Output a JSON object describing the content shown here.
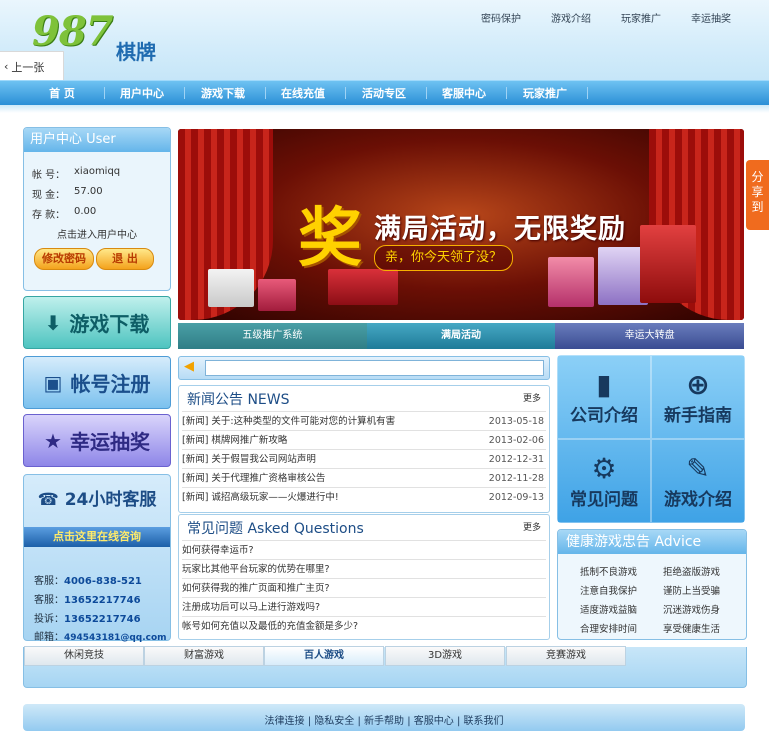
{
  "site": {
    "logo_number": "987",
    "logo_name": "棋牌"
  },
  "top_links": [
    "密码保护",
    "游戏介绍",
    "玩家推广",
    "幸运抽奖"
  ],
  "prev_button": "上一张",
  "nav": [
    "首 页",
    "用户中心",
    "游戏下载",
    "在线充值",
    "活动专区",
    "客服中心",
    "玩家推广"
  ],
  "user_panel": {
    "title": "用户中心 User",
    "account_label": "帐 号：",
    "account_value": "xiaomiqq",
    "cash_label": "现 金：",
    "cash_value": "57.00",
    "deposit_label": "存 款：",
    "deposit_value": "0.00",
    "enter_link": "点击进入用户中心",
    "change_pwd": "修改密码",
    "logout": "退 出"
  },
  "side_buttons": {
    "download": "游戏下载",
    "register": "帐号注册",
    "lottery": "幸运抽奖"
  },
  "service": {
    "title": "24小时客服",
    "online": "点击这里在线咨询",
    "lines": [
      {
        "label": "客服：",
        "value": "4006-838-521"
      },
      {
        "label": "客服：",
        "value": "13652217746"
      },
      {
        "label": "投诉：",
        "value": "13652217746"
      },
      {
        "label": "邮箱：",
        "value": "494543181@qq.com"
      }
    ]
  },
  "banner": {
    "big": "奖",
    "headline": "满局活动，无限奖励",
    "sub": "亲，你今天领了没？"
  },
  "banner_tabs": [
    "五级推广系统",
    "满局活动",
    "幸运大转盘"
  ],
  "news": {
    "title": "新闻公告 NEWS",
    "more": "更多",
    "items": [
      {
        "text": "[新闻] 关于:这种类型的文件可能对您的计算机有害",
        "date": "2013-05-18"
      },
      {
        "text": "[新闻] 棋牌网推广新攻略",
        "date": "2013-02-06"
      },
      {
        "text": "[新闻] 关于假冒我公司网站声明",
        "date": "2012-12-31"
      },
      {
        "text": "[新闻] 关于代理推广资格审核公告",
        "date": "2012-11-28"
      },
      {
        "text": "[新闻] 诚招高级玩家——火爆进行中!",
        "date": "2012-09-13"
      }
    ]
  },
  "faq": {
    "title": "常见问题 Asked Questions",
    "more": "更多",
    "items": [
      "如何获得幸运币?",
      "玩家比其他平台玩家的优势在哪里?",
      "如何获得我的推广页面和推广主页?",
      "注册成功后可以马上进行游戏吗?",
      "帐号如何充值以及最低的充值金额是多少?"
    ]
  },
  "quick": {
    "about": "公司介绍",
    "guide": "新手指南",
    "faq": "常见问题",
    "games": "游戏介绍"
  },
  "advice": {
    "title": "健康游戏忠告 Advice",
    "items": [
      "抵制不良游戏",
      "拒绝盗版游戏",
      "注意自我保护",
      "谨防上当受骗",
      "适度游戏益脑",
      "沉迷游戏伤身",
      "合理安排时间",
      "享受健康生活"
    ]
  },
  "game_tabs": [
    "休闲竞技",
    "财富游戏",
    "百人游戏",
    "3D游戏",
    "竞赛游戏"
  ],
  "footer_links": [
    "法律连接",
    "隐私安全",
    "新手帮助",
    "客服中心",
    "联系我们"
  ],
  "share": "分享到"
}
